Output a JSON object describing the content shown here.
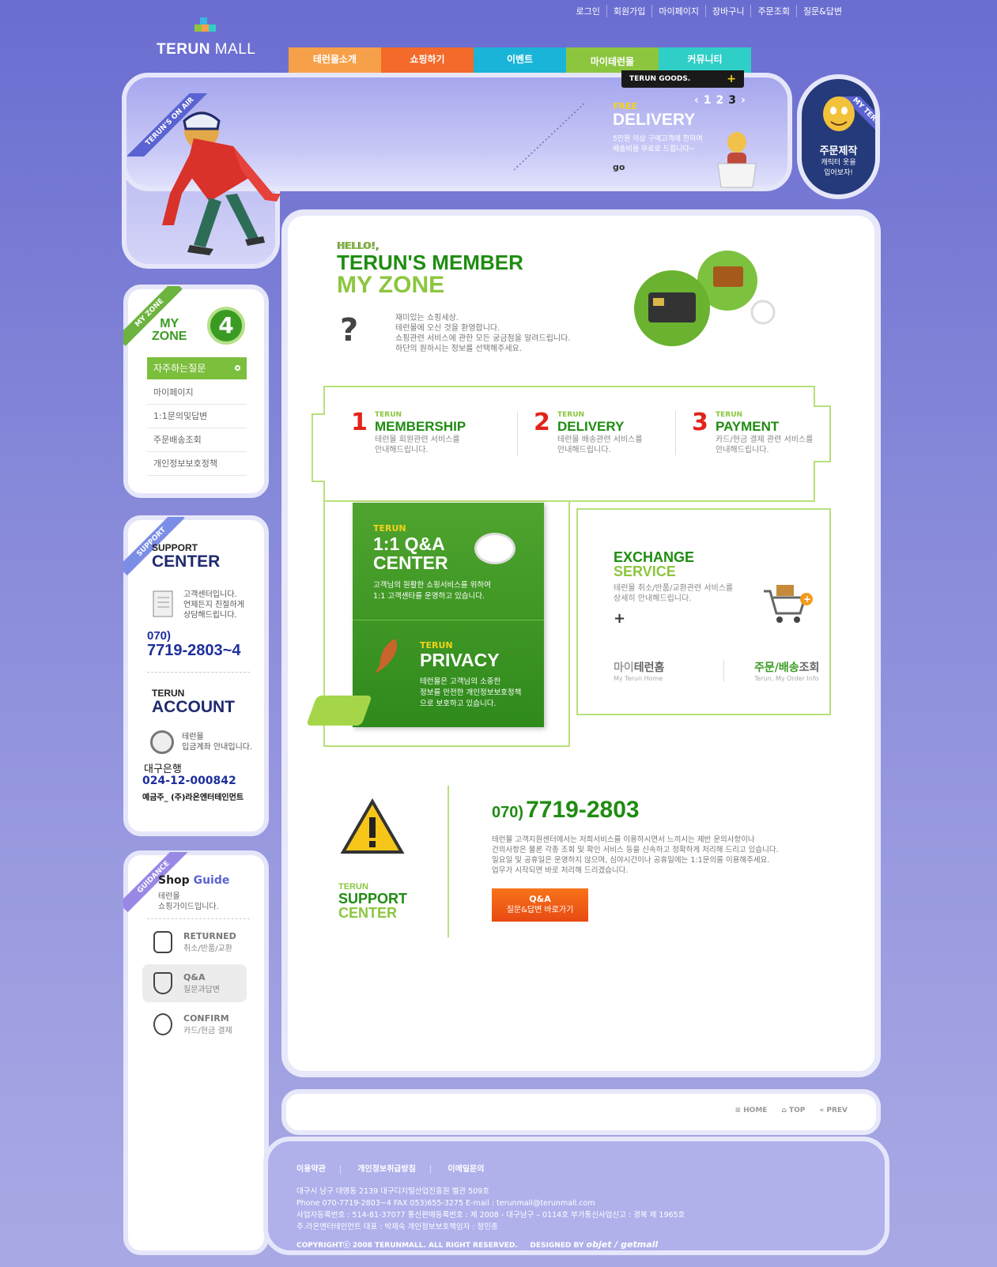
{
  "toplinks": [
    "로그인",
    "회원가입",
    "마이페이지",
    "장바구니",
    "주문조회",
    "질문&답변"
  ],
  "logo": {
    "name1": "TERUN",
    "name2": "MALL"
  },
  "nav": [
    {
      "label": "테런몰소개",
      "color": "#f7a04a"
    },
    {
      "label": "쇼핑하기",
      "color": "#f36a2a"
    },
    {
      "label": "이벤트",
      "color": "#19b4d8"
    },
    {
      "label": "마이테런몰",
      "color": "#8cc63f"
    },
    {
      "label": "커뮤니티",
      "color": "#2fcfc8"
    }
  ],
  "goods": "TERUN GOODS.",
  "banner": {
    "ribbon": "TERUN'S ON AIR",
    "free": "FREE",
    "delivery": "DELIVERY",
    "desc1": "5만원 이상 구매고객에 한하여",
    "desc2": "배송비를 무료로 드립니다~",
    "go": "go",
    "pages": [
      "1",
      "2",
      "3"
    ],
    "prev": "‹",
    "next": "›"
  },
  "myterun": {
    "ribbon": "MY TERUN",
    "title": "주문제작",
    "desc1": "캐릭터 옷을",
    "desc2": "입어보자!"
  },
  "myzone_side": {
    "ribbon": "MY ZONE",
    "title1": "MY",
    "title2": "ZONE",
    "num": "4",
    "active": "자주하는질문",
    "items": [
      "마이페이지",
      "1:1문의및답변",
      "주문배송조회",
      "개인정보보호정책"
    ]
  },
  "support_side": {
    "ribbon": "SUPPORT",
    "title1": "SUPPORT",
    "title2": "CENTER",
    "desc1": "고객센터입니다.",
    "desc2": "언제든지 친절하게",
    "desc3": "상담해드립니다.",
    "tel1": "070)",
    "tel2": "7719-2803~4",
    "acc1": "TERUN",
    "acc2": "ACCOUNT",
    "accdesc1": "테런몰",
    "accdesc2": "입금계좌 안내입니다.",
    "bank": "대구은행",
    "accnum": "024-12-000842",
    "holder": "예금주_ (주)라온엔터테인먼트"
  },
  "guide_side": {
    "ribbon": "GUIDANCE",
    "title1": "Shop",
    "title2": "Guide",
    "desc1": "테런몰",
    "desc2": "쇼핑가이드입니다.",
    "items": [
      {
        "t1": "RETURNED",
        "t2": "취소/반품/교환"
      },
      {
        "t1": "Q&A",
        "t2": "질문과답변"
      },
      {
        "t1": "CONFIRM",
        "t2": "카드/현금 결제"
      }
    ]
  },
  "main": {
    "hello": "HELLO!,",
    "title1": "TERUN'S MEMBER",
    "title2": "MY ZONE",
    "intro": [
      "재미있는 쇼핑세상.",
      "테런몰에 오신 것을 환영합니다.",
      "쇼핑관련 서비스에 관한 모든 궁금점을 알려드립니다.",
      "하단의 원하시는 정보를 선택해주세요."
    ],
    "services": [
      {
        "num": "1",
        "small": "TERUN",
        "title": "MEMBERSHIP",
        "d1": "테런몰 회원관련 서비스를",
        "d2": "안내해드립니다."
      },
      {
        "num": "2",
        "small": "TERUN",
        "title": "DELIVERY",
        "d1": "테런몰 배송관련 서비스를",
        "d2": "안내해드립니다."
      },
      {
        "num": "3",
        "small": "TERUN",
        "title": "PAYMENT",
        "d1": "카드/현금 결제 관련 서비스를",
        "d2": "안내해드립니다."
      }
    ],
    "qa": {
      "small": "TERUN",
      "t1": "1:1 Q&A",
      "t2": "CENTER",
      "d1": "고객님의 원활한 쇼핑서비스를 위하여",
      "d2": "1:1 고객센타를 운영하고 있습니다."
    },
    "privacy": {
      "small": "TERUN",
      "title": "PRIVACY",
      "d1": "테런몰은 고객님의 소중한",
      "d2": "정보를 안전한 개인정보보호정책",
      "d3": "으로 보호하고 있습니다."
    },
    "exchange": {
      "t1": "EXCHANGE",
      "t2": "SERVICE",
      "d1": "테런몰 취소/반품/교환관련 서비스를",
      "d2": "상세히 안내해드립니다.",
      "plus": "+"
    },
    "links": [
      {
        "a": "마이",
        "b": "테런홈",
        "sub": "My Terun Home"
      },
      {
        "a": "주문/배송",
        "b": "조회",
        "sub": "Terun, My Order Info"
      }
    ],
    "support": {
      "small": "TERUN",
      "t1": "SUPPORT",
      "t2": "CENTER",
      "tel1": "070)",
      "tel2": "7719-2803",
      "desc": [
        "테런몰 고객지원센터에서는 저희서비스를 이용하시면서 느끼시는 제반 문의사항이나",
        "건의사항은 물론 각종 조회 및 확인 서비스 등을 신속하고 정확하게 처리해 드리고 있습니다.",
        "일요일 및 공휴일은 운영하지 않으며, 심야시간이나 공휴일에는 1:1문의를 이용해주세요.",
        "업무가 시작되면 바로 처리해 드리겠습니다."
      ],
      "btn1": "Q&A",
      "btn2": "질문&답변 바로가기"
    }
  },
  "bottomnav": [
    "HOME",
    "TOP",
    "PREV"
  ],
  "footer": {
    "links": [
      "이용약관",
      "개인정보취급방침",
      "이메일문의"
    ],
    "addr": [
      "대구시 남구 대명동 2139 대구디지털산업진흥원 별관 509호",
      "Phone 070-7719-2803~4  FAX 053)655-3275  E-mail : terunmall@terunmall.com",
      "사업자등록번호 : 514-81-37077 통신판매등록번호 :  제 2008 - 대구남구 – 0114호  부가통신사업신고 : 경북 제 1965호",
      "주.라온엔터테인먼트  대표 : 박재숙  개인정보보호책임자 : 정민종"
    ],
    "copyright": "COPYRIGHTⓒ 2008 TERUNMALL. ALL RIGHT RESERVED.",
    "designed": "DESIGNED BY",
    "designers": "objet / getmall"
  }
}
